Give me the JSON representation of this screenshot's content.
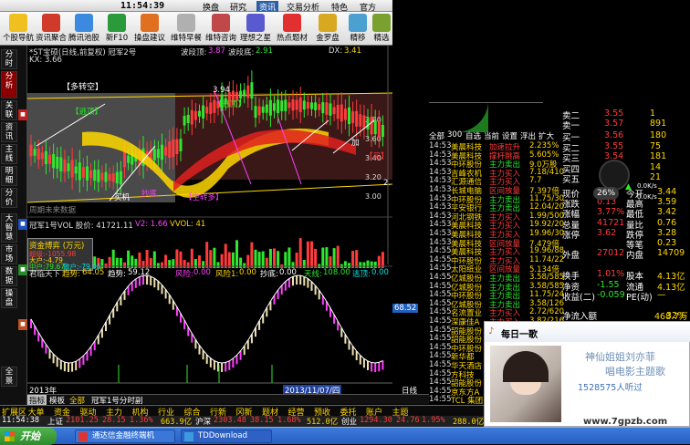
{
  "window": {
    "clock": "11:54:39"
  },
  "menu": {
    "items": [
      "换盘",
      "研究",
      "资讯",
      "交易分析",
      "特色",
      "官方"
    ]
  },
  "toolbar": {
    "buttons": [
      "个股导航",
      "资讯聚合",
      "腾讯池股",
      "新F10",
      "操盘建议",
      "维特早餐",
      "维特咨询",
      "理想之星",
      "热点题材",
      "金罗盘",
      "精移",
      "精选"
    ]
  },
  "lefttabs": {
    "items": [
      "分时",
      "分析",
      "关联",
      "资讯",
      "主线",
      "明细",
      "分价",
      "大智慧",
      "市场",
      "数据",
      "操盘",
      "全景"
    ],
    "selected": "分析"
  },
  "chart": {
    "title": "*ST宝硕(日线,前复权) 冠军2号",
    "wave_hi_label": "波段顶:",
    "wave_hi": "3.87",
    "wave_lo_label": "波段底:",
    "wave_lo": "2.91",
    "dx_label": "DX:",
    "dx": "3.41",
    "kx": "KX: 3.66",
    "ann_multi_short": "【多转空】",
    "ann_escape_top": "【逃顶】",
    "ann_escape_top2": "【逃顶】",
    "ann_buy": "【买】",
    "ann_add": "加",
    "ann_buy_chance": "买机",
    "ann_swing_bottom": "抄底",
    "ann_empty_multi": "【空转多】",
    "peak_price": "3.94",
    "low_price": "2.",
    "future_label": "周期未来数据",
    "price_ticks": [
      "3.80",
      "3.60",
      "3.40",
      "3.20",
      "3.00"
    ],
    "vol_title": "冠军1号VOL 股价: 41721.11",
    "vol_v2": "V2: 1.66",
    "vol_vvol": "VVOL: 41",
    "vol_ticks": [
      "40000",
      "20000"
    ],
    "money_title": "资金博弈 (万元)",
    "money_legend": [
      "超级:-1055.98",
      "大户:-4.79",
      "中户:79.67",
      "散户:-79.96"
    ],
    "osc_title": "君临天下",
    "osc_trend_label": "趋势:",
    "osc_trend": "64.05",
    "osc_trend2_label": "趋势:",
    "osc_trend2": "59.12",
    "osc_risk_label": "风险:",
    "osc_risk": "0.00",
    "osc_risk2_label": "风险1:",
    "osc_risk2": "0.00",
    "osc_bottom_label": "抄底:",
    "osc_bottom": "0.00",
    "osc_sky_label": "天线:",
    "osc_sky": "108.00",
    "osc_escape_label": "逃顶:",
    "osc_escape": "0.00",
    "osc_badge": "68.52",
    "osc_ticks": [
      "50.00"
    ],
    "axis_year": "2013年",
    "axis_date": "2013/11/07/四",
    "axis_right": "日线"
  },
  "bottomtabs": {
    "items": [
      "指标",
      "模板",
      "全部",
      "冠军1号分时副"
    ],
    "selected": "指标"
  },
  "botnav": {
    "items": [
      "扩展区",
      "大单",
      "资金",
      "驱动",
      "主力",
      "机构",
      "行业",
      "综合",
      "行新",
      "冈新",
      "题材",
      "经营",
      "预收",
      "委托",
      "账户",
      "主题"
    ]
  },
  "statusbar": {
    "time": "11:54:38",
    "index1": "上证",
    "v1": "2101.25",
    "v1c": "28.15",
    "v1p": "1.36%",
    "v1a": "663.9亿",
    "index2": "沪深",
    "v2": "2303.48",
    "v2c": "38.15",
    "v2p": "1.68%",
    "v2a": "512.0亿",
    "index3": "创业",
    "v3": "1294.30",
    "v3c": "24.76",
    "v3p": "1.95%",
    "v3a": "288.0亿"
  },
  "rightpanel": {
    "asks": [
      {
        "k": "卖二",
        "p": "3.55",
        "v": "1"
      },
      {
        "k": "卖一",
        "p": "3.57",
        "v": "891"
      }
    ],
    "bids": [
      {
        "k": "买一",
        "p": "3.56",
        "v": "180"
      },
      {
        "k": "买二",
        "p": "3.55",
        "v": "75"
      },
      {
        "k": "买三",
        "p": "3.54",
        "v": "181"
      },
      {
        "k": "买四",
        "p": "3.53",
        "v": "14"
      },
      {
        "k": "买五",
        "p": "3.52",
        "v": "21"
      }
    ],
    "ticker_tabs": [
      "全部",
      "300",
      "自选",
      "当前",
      "设置",
      "浮出",
      "扩大"
    ],
    "trades": [
      {
        "t": "14:53",
        "n": "美晨科技",
        "k": "加速拉升",
        "v": "2.235%"
      },
      {
        "t": "14:53",
        "n": "美晨科技",
        "k": "撑杆跳高",
        "v": "5.605%"
      },
      {
        "t": "14:53",
        "n": "中环股份",
        "k": "主力卖出",
        "v": "9.0万股"
      },
      {
        "t": "14:53",
        "n": "吉峰农机",
        "k": "主力买入",
        "v": "7.18/410"
      },
      {
        "t": "14:53",
        "n": "汇源通信",
        "k": "主力买入",
        "v": "7.7"
      },
      {
        "t": "14:53",
        "n": "长城电脑",
        "k": "区间放量",
        "v": "7.397倍"
      },
      {
        "t": "14:53",
        "n": "中环股份",
        "k": "主力卖出",
        "v": "11.75/30"
      },
      {
        "t": "14:53",
        "n": "平安银行",
        "k": "主力卖出",
        "v": "12.04/20"
      },
      {
        "t": "14:53",
        "n": "河北钢铁",
        "k": "主力买入",
        "v": "1.99/500"
      },
      {
        "t": "14:53",
        "n": "美晨科技",
        "k": "主力买入",
        "v": "19.92/20"
      },
      {
        "t": "14:53",
        "n": "美晨科技",
        "k": "主力买入",
        "v": "19.96/30"
      },
      {
        "t": "14:53",
        "n": "美晨科技",
        "k": "区间放量",
        "v": "7.479倍"
      },
      {
        "t": "14:55",
        "n": "美晨科技",
        "k": "主力买入",
        "v": "19.96/88"
      },
      {
        "t": "14:55",
        "n": "中环股份",
        "k": "主力买入",
        "v": "11.74/22"
      },
      {
        "t": "14:55",
        "n": "太阳纸业",
        "k": "区间放量",
        "v": "5.134倍"
      },
      {
        "t": "14:55",
        "n": "亿城股份",
        "k": "主力卖出",
        "v": "3.58/585"
      },
      {
        "t": "14:55",
        "n": "亿城股份",
        "k": "主力卖出",
        "v": "3.58/585"
      },
      {
        "t": "14:55",
        "n": "中环股份",
        "k": "主力卖出",
        "v": "11.75/24"
      },
      {
        "t": "14:55",
        "n": "亿城股份",
        "k": "主力卖出",
        "v": "3.58/126"
      },
      {
        "t": "14:55",
        "n": "名流置业",
        "k": "主力买入",
        "v": "2.72/620"
      },
      {
        "t": "14:55",
        "n": "深康佳A",
        "k": "主力买入",
        "v": "3.82/216"
      },
      {
        "t": "14:55",
        "n": "韶能股份",
        "k": "主力买入",
        "v": "6.95/118"
      },
      {
        "t": "14:55",
        "n": "韶能股份",
        "k": "主力买入",
        "v": "6.95/118"
      },
      {
        "t": "14:55",
        "n": "中环股份",
        "k": "主力买入",
        "v": "11.7"
      },
      {
        "t": "14:55",
        "n": "新华都",
        "k": "主力买入",
        "v": "7.98"
      },
      {
        "t": "14:55",
        "n": "华天酒店",
        "k": "区间放量",
        "v": "4.3"
      },
      {
        "t": "14:55",
        "n": "方科技",
        "k": "主力买入",
        "v": "7.1"
      },
      {
        "t": "14:55",
        "n": "韶能股份",
        "k": "主力买入",
        "v": "6.9"
      },
      {
        "t": "14:55",
        "n": "京东方A",
        "k": "主力卖出",
        "v": "3"
      },
      {
        "t": "14:55",
        "n": "TCL 集团",
        "k": "区间放量",
        "v": "4"
      }
    ],
    "quote": [
      {
        "k": "现价",
        "v": "3.57",
        "k2": "今开",
        "v2": "3.44"
      },
      {
        "k": "涨跌",
        "v": "0.13",
        "k2": "最高",
        "v2": "3.59"
      },
      {
        "k": "涨幅",
        "v": "3.77%",
        "k2": "最低",
        "v2": "3.42"
      },
      {
        "k": "总量",
        "v": "41721",
        "k2": "量比",
        "v2": "0.76"
      },
      {
        "k": "涨停",
        "v": "3.62",
        "k2": "跌停",
        "v2": "3.28"
      },
      {
        "k": "",
        "v": "",
        "k2": "等笔",
        "v2": "0.23"
      },
      {
        "k": "外盘",
        "v": "27012",
        "k2": "内盘",
        "v2": "14709"
      },
      {
        "k": "换手",
        "v": "1.01%",
        "k2": "股本",
        "v2": "4.13亿"
      },
      {
        "k": "净资",
        "v": "-1.55",
        "k2": "流通",
        "v2": "4.13亿"
      },
      {
        "k": "收益(二)",
        "v": "-0.059",
        "k2": "PE(动)",
        "v2": "—"
      }
    ],
    "inflow_label": "净流入额",
    "inflow": "468.7万",
    "inflow_pct": "32%",
    "gauge_pct": "26%",
    "gauge_speed": "0.0K/s",
    "gauge_speed2": "0.0K/s"
  },
  "popup": {
    "title": "每日一歌",
    "line1": "神仙姐姐刘亦菲",
    "line2": "唱电影主题歌",
    "listeners": "1528575人听过",
    "watermark": "www.7gpzb.com"
  },
  "taskbar": {
    "start": "开始",
    "tasks": [
      "通达信金融终端机",
      "TDDownload"
    ]
  },
  "colors": {
    "up": "#ff3b3b",
    "down": "#00e0e0",
    "yellow": "#ffd800",
    "green": "#2ee82e",
    "magenta": "#ff40ff"
  }
}
